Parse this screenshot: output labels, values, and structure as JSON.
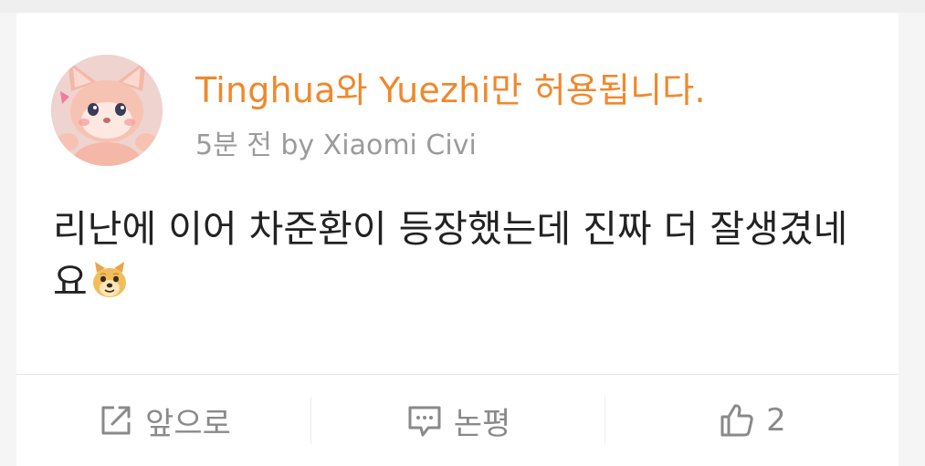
{
  "post": {
    "username": "Tinghua와 Yuezhi만 허용됩니다.",
    "meta": "5분 전 by Xiaomi Civi",
    "text": "리난에 이어 차준환이 등장했는데 진짜 더 잘생겼네요",
    "emoji_icon": "doge-emoji-icon",
    "avatar_icon": "pink-fox-plush-avatar"
  },
  "actions": {
    "forward_label": "앞으로",
    "comment_label": "논평",
    "like_count": "2"
  },
  "colors": {
    "username": "#f0882c",
    "meta": "#9b9b9b",
    "text": "#222222",
    "action": "#8a8a8a"
  }
}
